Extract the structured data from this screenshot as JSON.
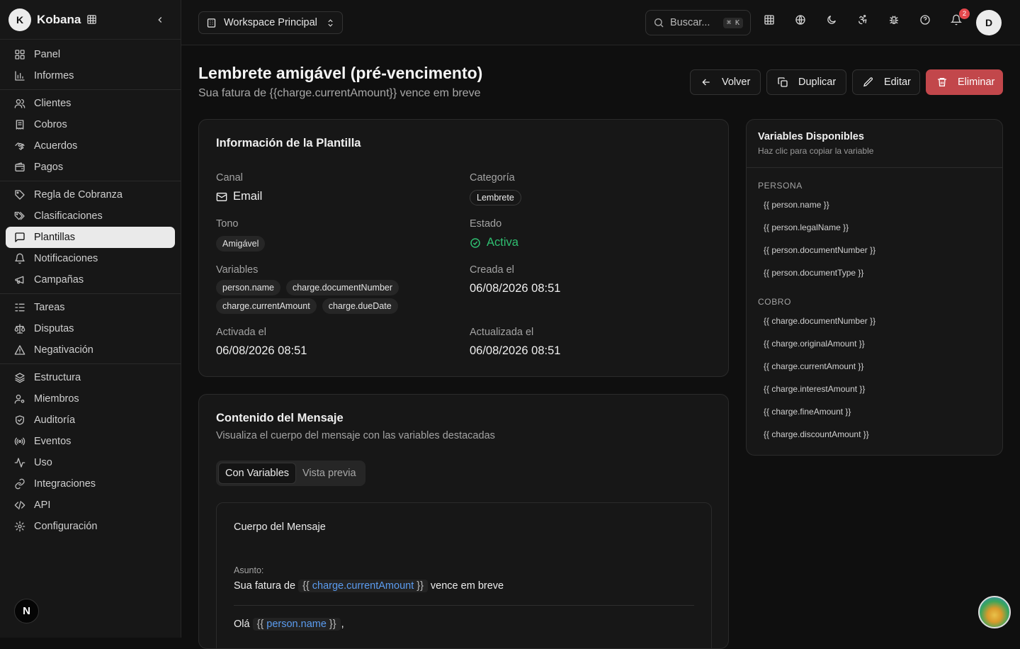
{
  "sidebar": {
    "brand_letter": "K",
    "brand_name": "Kobana",
    "groups": [
      [
        {
          "label": "Panel",
          "icon": "dashboard-icon"
        },
        {
          "label": "Informes",
          "icon": "bar-chart-icon"
        }
      ],
      [
        {
          "label": "Clientes",
          "icon": "users-icon"
        },
        {
          "label": "Cobros",
          "icon": "receipt-icon"
        },
        {
          "label": "Acuerdos",
          "icon": "handshake-icon"
        },
        {
          "label": "Pagos",
          "icon": "wallet-icon"
        }
      ],
      [
        {
          "label": "Regla de Cobranza",
          "icon": "tag-icon"
        },
        {
          "label": "Clasificaciones",
          "icon": "tags-icon"
        },
        {
          "label": "Plantillas",
          "icon": "message-square-icon",
          "active": true
        },
        {
          "label": "Notificaciones",
          "icon": "bell-icon"
        },
        {
          "label": "Campañas",
          "icon": "megaphone-icon"
        }
      ],
      [
        {
          "label": "Tareas",
          "icon": "list-todo-icon"
        },
        {
          "label": "Disputas",
          "icon": "scale-icon"
        },
        {
          "label": "Negativación",
          "icon": "alert-triangle-icon"
        }
      ],
      [
        {
          "label": "Estructura",
          "icon": "layers-icon"
        },
        {
          "label": "Miembros",
          "icon": "user-cog-icon"
        },
        {
          "label": "Auditoría",
          "icon": "shield-check-icon"
        },
        {
          "label": "Eventos",
          "icon": "radio-icon"
        },
        {
          "label": "Uso",
          "icon": "activity-icon"
        },
        {
          "label": "Integraciones",
          "icon": "link-icon"
        },
        {
          "label": "API",
          "icon": "code-icon"
        },
        {
          "label": "Configuración",
          "icon": "settings-icon"
        }
      ]
    ],
    "footer_badge": "N"
  },
  "topbar": {
    "workspace": "Workspace Principal",
    "search_placeholder": "Buscar...",
    "search_shortcut": "⌘ K",
    "notification_count": "2",
    "avatar_letter": "D"
  },
  "page": {
    "title": "Lembrete amigável (pré-vencimento)",
    "subtitle": "Sua fatura de {{charge.currentAmount}} vence em breve",
    "actions": {
      "back": "Volver",
      "duplicate": "Duplicar",
      "edit": "Editar",
      "delete": "Eliminar"
    }
  },
  "info": {
    "title": "Información de la Plantilla",
    "canal_label": "Canal",
    "canal_value": "Email",
    "categoria_label": "Categoría",
    "categoria_value": "Lembrete",
    "tono_label": "Tono",
    "tono_value": "Amigável",
    "estado_label": "Estado",
    "estado_value": "Activa",
    "variables_label": "Variables",
    "variables": [
      "person.name",
      "charge.documentNumber",
      "charge.currentAmount",
      "charge.dueDate"
    ],
    "creada_label": "Creada el",
    "creada_value": "06/08/2026 08:51",
    "activada_label": "Activada el",
    "activada_value": "06/08/2026 08:51",
    "actualizada_label": "Actualizada el",
    "actualizada_value": "06/08/2026 08:51"
  },
  "content": {
    "title": "Contenido del Mensaje",
    "subtitle": "Visualiza el cuerpo del mensaje con las variables destacadas",
    "tab_variables": "Con Variables",
    "tab_preview": "Vista previa",
    "body_title": "Cuerpo del Mensaje",
    "subject_label": "Asunto:",
    "subject_before": "Sua fatura de",
    "subject_var": "charge.currentAmount",
    "subject_after": "vence em breve",
    "body_greeting": "Olá",
    "body_var": "person.name",
    "body_punct": ",",
    "brace_open": "{{",
    "brace_close": "}}"
  },
  "variables_panel": {
    "title": "Variables Disponibles",
    "hint": "Haz clic para copiar la variable",
    "sections": [
      {
        "name": "PERSONA",
        "items": [
          "{{ person.name }}",
          "{{ person.legalName }}",
          "{{ person.documentNumber }}",
          "{{ person.documentType }}"
        ]
      },
      {
        "name": "COBRO",
        "items": [
          "{{ charge.documentNumber }}",
          "{{ charge.originalAmount }}",
          "{{ charge.currentAmount }}",
          "{{ charge.interestAmount }}",
          "{{ charge.fineAmount }}",
          "{{ charge.discountAmount }}"
        ]
      }
    ]
  },
  "colors": {
    "accent": "#5b9cf0",
    "success": "#2fbf71",
    "danger": "#c2474b"
  }
}
